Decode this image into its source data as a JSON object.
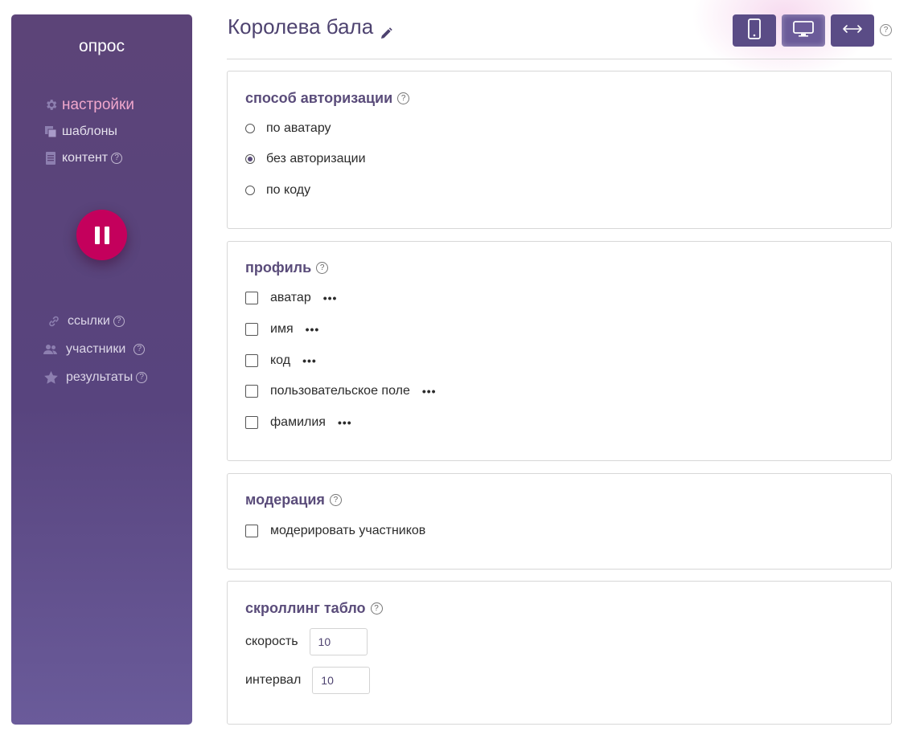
{
  "sidebar": {
    "title": "опрос",
    "nav_top": [
      {
        "label": "настройки",
        "icon": "gear-icon",
        "active": true
      },
      {
        "label": "шаблоны",
        "icon": "templates-icon"
      },
      {
        "label": "контент",
        "icon": "document-icon",
        "help": "?"
      }
    ],
    "nav_bottom": [
      {
        "label": "ссылки",
        "icon": "link-icon",
        "help": "?"
      },
      {
        "label": "участники",
        "icon": "users-icon",
        "help": "?"
      },
      {
        "label": "результаты",
        "icon": "star-icon",
        "help": "?"
      }
    ]
  },
  "header": {
    "title": "Королева бала",
    "view_buttons": [
      "mobile-icon",
      "desktop-icon",
      "horizontal-arrows-icon"
    ],
    "help": "?"
  },
  "auth": {
    "title": "способ авторизации",
    "help": "?",
    "options": [
      {
        "label": "по аватару",
        "checked": false
      },
      {
        "label": "без авторизации",
        "checked": true
      },
      {
        "label": "по коду",
        "checked": false
      }
    ]
  },
  "profile": {
    "title": "профиль",
    "help": "?",
    "fields": [
      {
        "label": "аватар",
        "more": "•••"
      },
      {
        "label": "имя",
        "more": "•••"
      },
      {
        "label": "код",
        "more": "•••"
      },
      {
        "label": "пользовательское поле",
        "more": "•••"
      },
      {
        "label": "фамилия",
        "more": "•••"
      }
    ]
  },
  "moderation": {
    "title": "модерация",
    "help": "?",
    "option": "модерировать участников"
  },
  "scroll": {
    "title": "скроллинг табло",
    "help": "?",
    "speed_label": "скорость",
    "speed_value": "10",
    "interval_label": "интервал",
    "interval_value": "10"
  },
  "colors": {
    "sidebar": "#5c4478",
    "accent": "#c4005c",
    "active_nav": "#f0a7cc",
    "heading": "#5a4c7a"
  }
}
